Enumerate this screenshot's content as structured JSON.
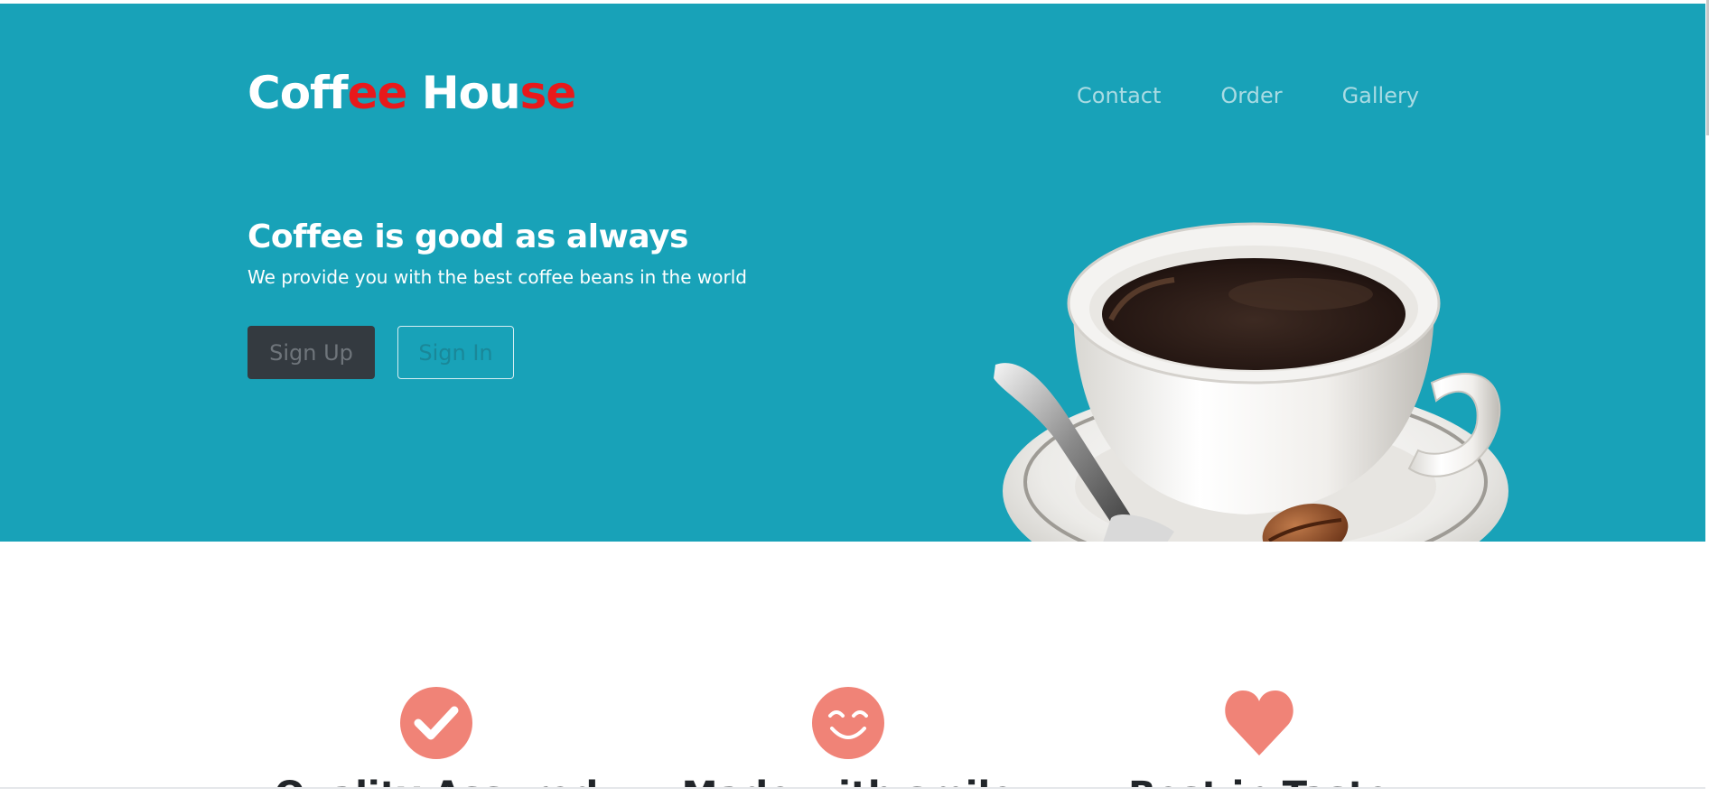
{
  "brand": {
    "part1": "Coff",
    "part2": "ee",
    "part3": " Hou",
    "part4": "se",
    "accent_color": "#e8191b"
  },
  "nav": {
    "items": [
      {
        "label": "Contact"
      },
      {
        "label": "Order"
      },
      {
        "label": "Gallery"
      }
    ]
  },
  "hero": {
    "title": "Coffee is good as always",
    "subtitle": "We provide you with the best coffee beans in the world",
    "signup_label": "Sign Up",
    "signin_label": "Sign In",
    "background_color": "#18a2b8",
    "image": "coffee-cup-illustration"
  },
  "features": [
    {
      "icon": "check-circle-icon",
      "title": "Quality Assured",
      "color": "#f08377"
    },
    {
      "icon": "smile-icon",
      "title": "Made with smile",
      "color": "#f08377"
    },
    {
      "icon": "heart-icon",
      "title": "Best in Taste",
      "color": "#f08377"
    }
  ]
}
